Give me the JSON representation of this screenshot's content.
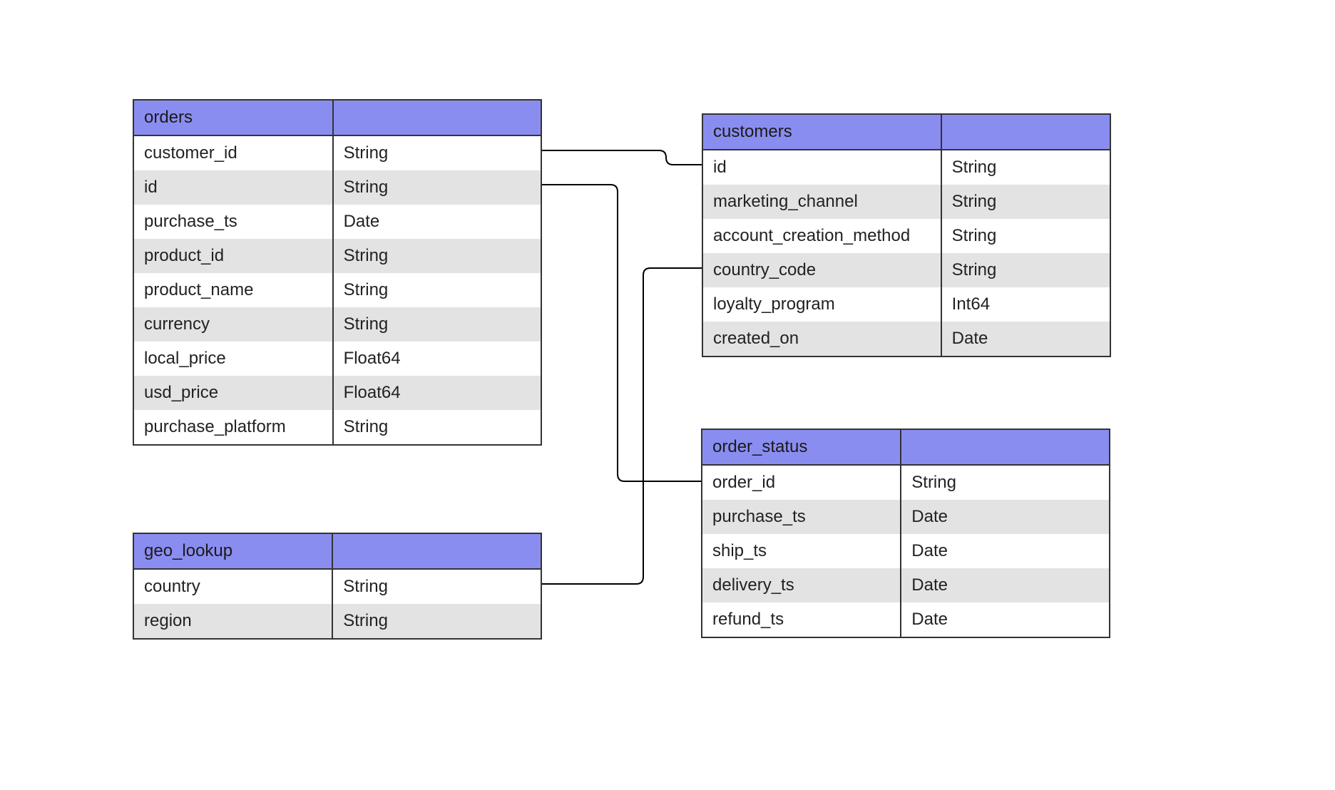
{
  "tables": {
    "orders": {
      "title": "orders",
      "columns": [
        {
          "name": "customer_id",
          "type": "String"
        },
        {
          "name": "id",
          "type": "String"
        },
        {
          "name": "purchase_ts",
          "type": "Date"
        },
        {
          "name": "product_id",
          "type": "String"
        },
        {
          "name": "product_name",
          "type": "String"
        },
        {
          "name": "currency",
          "type": "String"
        },
        {
          "name": "local_price",
          "type": "Float64"
        },
        {
          "name": "usd_price",
          "type": "Float64"
        },
        {
          "name": "purchase_platform",
          "type": "String"
        }
      ]
    },
    "customers": {
      "title": "customers",
      "columns": [
        {
          "name": "id",
          "type": "String"
        },
        {
          "name": "marketing_channel",
          "type": "String"
        },
        {
          "name": "account_creation_method",
          "type": "String"
        },
        {
          "name": "country_code",
          "type": "String"
        },
        {
          "name": "loyalty_program",
          "type": "Int64"
        },
        {
          "name": "created_on",
          "type": "Date"
        }
      ]
    },
    "geo_lookup": {
      "title": "geo_lookup",
      "columns": [
        {
          "name": "country",
          "type": "String"
        },
        {
          "name": "region",
          "type": "String"
        }
      ]
    },
    "order_status": {
      "title": "order_status",
      "columns": [
        {
          "name": "order_id",
          "type": "String"
        },
        {
          "name": "purchase_ts",
          "type": "Date"
        },
        {
          "name": "ship_ts",
          "type": "Date"
        },
        {
          "name": "delivery_ts",
          "type": "Date"
        },
        {
          "name": "refund_ts",
          "type": "Date"
        }
      ]
    }
  },
  "relationships": [
    {
      "from": "orders.customer_id",
      "to": "customers.id"
    },
    {
      "from": "orders.id",
      "to": "order_status.order_id"
    },
    {
      "from": "geo_lookup.country",
      "to": "customers.country_code"
    }
  ]
}
